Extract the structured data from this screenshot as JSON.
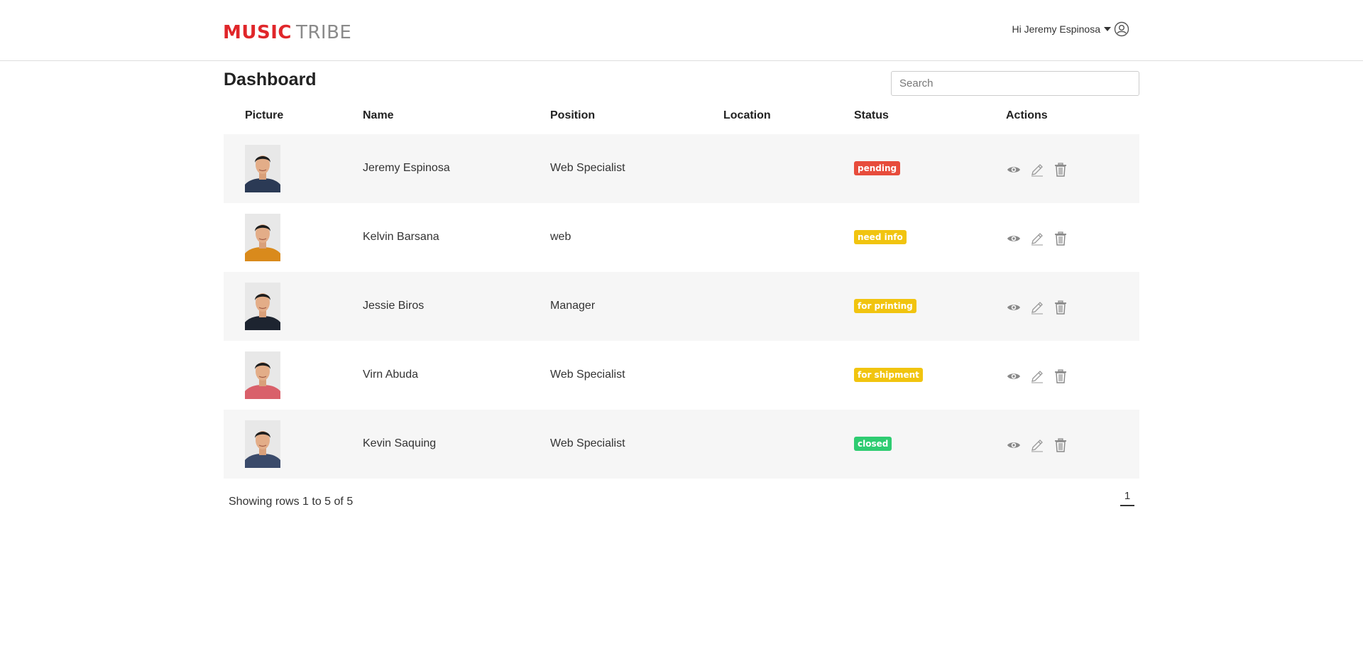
{
  "header": {
    "logo_part1": "MUSIC",
    "logo_part2": "TRIBE",
    "greeting": "Hi Jeremy Espinosa",
    "brand_color": "#e0262a"
  },
  "page": {
    "title": "Dashboard",
    "search_placeholder": "Search"
  },
  "table": {
    "columns": [
      "Picture",
      "Name",
      "Position",
      "Location",
      "Status",
      "Actions"
    ],
    "rows": [
      {
        "name": "Jeremy Espinosa",
        "position": "Web Specialist",
        "location": "",
        "status": "pending",
        "status_color": "#e74c3c",
        "shirt": "#2b3a55"
      },
      {
        "name": "Kelvin Barsana",
        "position": "web",
        "location": "",
        "status": "need info",
        "status_color": "#f1c40f",
        "shirt": "#d98a1c"
      },
      {
        "name": "Jessie Biros",
        "position": "Manager",
        "location": "",
        "status": "for printing",
        "status_color": "#f1c40f",
        "shirt": "#1d2430"
      },
      {
        "name": "Virn Abuda",
        "position": "Web Specialist",
        "location": "",
        "status": "for shipment",
        "status_color": "#f1c40f",
        "shirt": "#d9606a"
      },
      {
        "name": "Kevin Saquing",
        "position": "Web Specialist",
        "location": "",
        "status": "closed",
        "status_color": "#2ecc71",
        "shirt": "#3a4a6a"
      }
    ],
    "action_icons": [
      "eye-icon",
      "pencil-icon",
      "trash-icon"
    ]
  },
  "footer": {
    "showing": "Showing rows 1 to 5 of 5",
    "page": "1"
  }
}
